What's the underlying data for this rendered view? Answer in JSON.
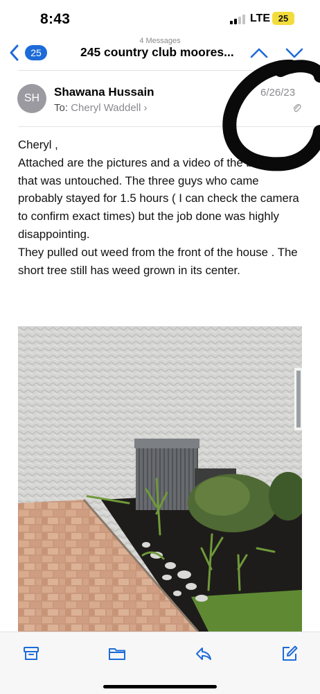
{
  "status_bar": {
    "time": "8:43",
    "network": "LTE",
    "battery": "25"
  },
  "nav": {
    "back_count": "25",
    "message_count": "4 Messages",
    "thread_title": "245 country club moores...",
    "accent_color": "#1d6bd8"
  },
  "message": {
    "avatar_initials": "SH",
    "sender": "Shawana Hussain",
    "to_label": "To:",
    "recipient": "Cheryl Waddell",
    "date": "6/26/23",
    "greeting": "Cheryl ,",
    "paragraph_1": "Attached are the pictures and a video of the backyard that was untouched. The three guys who came probably stayed for 1.5 hours ( I can check the camera to confirm exact times) but the job done was highly disappointing.",
    "paragraph_2": "They pulled out weed from the front of the house . The short tree still has weed grown in its center."
  },
  "toolbar": {
    "icons": [
      "archive-icon",
      "folder-icon",
      "reply-icon",
      "compose-icon"
    ]
  }
}
